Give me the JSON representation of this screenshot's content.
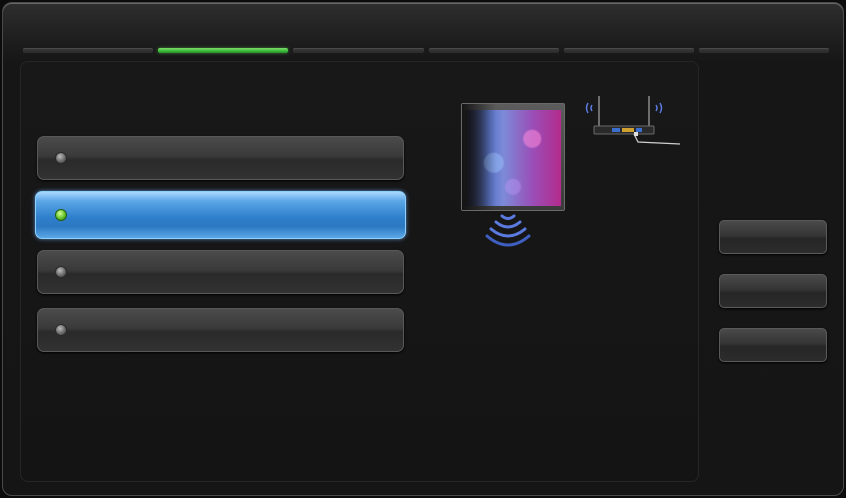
{
  "progress": {
    "steps": 6,
    "active_step": 2
  },
  "options": [
    {
      "label": "",
      "selected": false
    },
    {
      "label": "",
      "selected": true
    },
    {
      "label": "",
      "selected": false
    },
    {
      "label": "",
      "selected": false
    }
  ],
  "side_buttons": [
    {
      "label": ""
    },
    {
      "label": ""
    },
    {
      "label": ""
    }
  ],
  "colors": {
    "accent_green": "#3bb83a",
    "selection_blue": "#2f7fcc",
    "signal_blue": "#5a7ae0"
  },
  "icons": {
    "tv": "tv-icon",
    "signal": "wireless-signal-icon",
    "router": "router-icon"
  }
}
